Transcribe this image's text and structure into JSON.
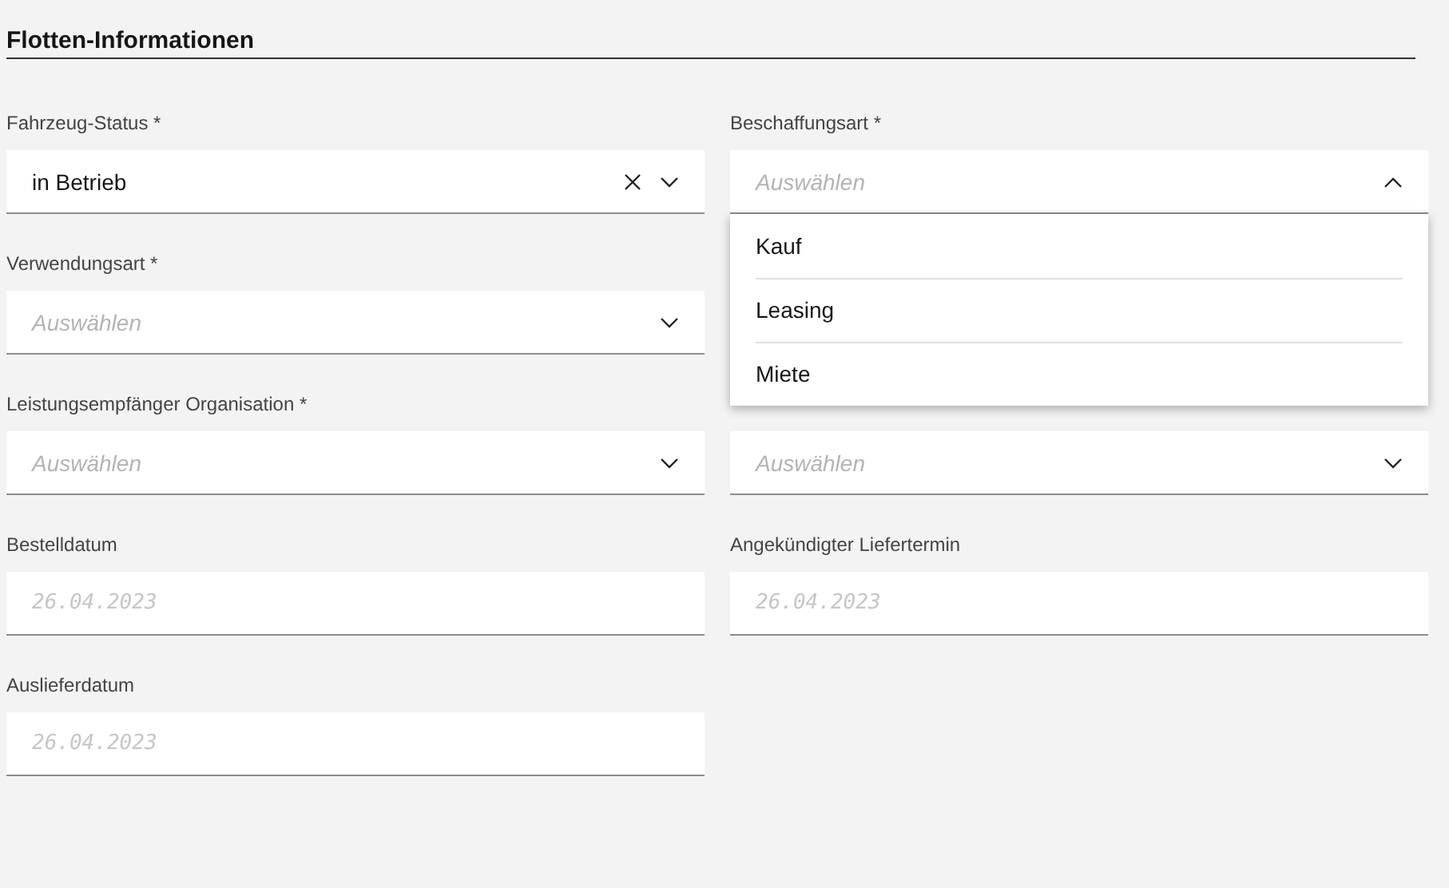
{
  "title": "Flotten-Informationen",
  "rows": [
    [
      {
        "kind": "select",
        "label": "Fahrzeug-Status *",
        "value": "in Betrieb",
        "clearable": true,
        "open": false
      },
      {
        "kind": "select",
        "label": "Beschaffungsart *",
        "placeholder": "Auswählen",
        "clearable": false,
        "open": true,
        "options": [
          "Kauf",
          "Leasing",
          "Miete"
        ]
      }
    ],
    [
      {
        "kind": "select",
        "label": "Verwendungsart *",
        "placeholder": "Auswählen",
        "clearable": false,
        "open": false
      }
    ],
    [
      {
        "kind": "select",
        "label": "Leistungsempfänger Organisation *",
        "placeholder": "Auswählen",
        "clearable": false,
        "open": false
      },
      {
        "kind": "select",
        "placeholder": "Auswählen",
        "clearable": false,
        "open": false
      }
    ],
    [
      {
        "kind": "date",
        "label": "Bestelldatum",
        "placeholder": "26.04.2023"
      },
      {
        "kind": "date",
        "label": "Angekündigter Liefertermin",
        "placeholder": "26.04.2023"
      }
    ],
    [
      {
        "kind": "date",
        "label": "Auslieferdatum",
        "placeholder": "26.04.2023"
      }
    ]
  ]
}
